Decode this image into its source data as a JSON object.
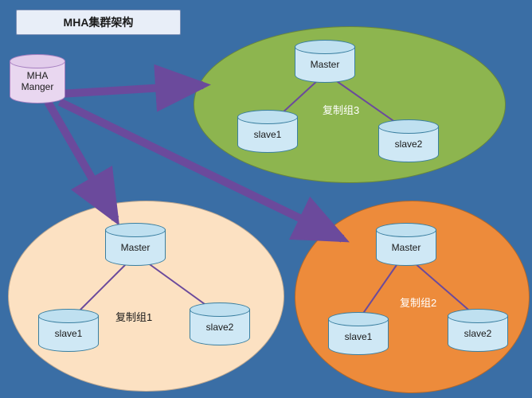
{
  "title": "MHA集群架构",
  "manager": {
    "label": "MHA\nManger"
  },
  "groups": {
    "g1": {
      "label": "复制组1",
      "master": "Master",
      "slave1": "slave1",
      "slave2": "slave2"
    },
    "g2": {
      "label": "复制组2",
      "master": "Master",
      "slave1": "slave1",
      "slave2": "slave2"
    },
    "g3": {
      "label": "复制组3",
      "master": "Master",
      "slave1": "slave1",
      "slave2": "slave2"
    }
  },
  "chart_data": {
    "type": "diagram",
    "title": "MHA集群架构",
    "nodes": [
      {
        "id": "manager",
        "label": "MHA Manger",
        "type": "manager"
      },
      {
        "id": "g1",
        "label": "复制组1",
        "type": "replication-group",
        "members": [
          {
            "id": "g1-master",
            "label": "Master",
            "role": "master"
          },
          {
            "id": "g1-slave1",
            "label": "slave1",
            "role": "slave"
          },
          {
            "id": "g1-slave2",
            "label": "slave2",
            "role": "slave"
          }
        ]
      },
      {
        "id": "g2",
        "label": "复制组2",
        "type": "replication-group",
        "members": [
          {
            "id": "g2-master",
            "label": "Master",
            "role": "master"
          },
          {
            "id": "g2-slave1",
            "label": "slave1",
            "role": "slave"
          },
          {
            "id": "g2-slave2",
            "label": "slave2",
            "role": "slave"
          }
        ]
      },
      {
        "id": "g3",
        "label": "复制组3",
        "type": "replication-group",
        "members": [
          {
            "id": "g3-master",
            "label": "Master",
            "role": "master"
          },
          {
            "id": "g3-slave1",
            "label": "slave1",
            "role": "slave"
          },
          {
            "id": "g3-slave2",
            "label": "slave2",
            "role": "slave"
          }
        ]
      }
    ],
    "edges": [
      {
        "from": "manager",
        "to": "g1",
        "type": "manages"
      },
      {
        "from": "manager",
        "to": "g2",
        "type": "manages"
      },
      {
        "from": "manager",
        "to": "g3",
        "type": "manages"
      },
      {
        "from": "g1-master",
        "to": "g1-slave1",
        "type": "replication"
      },
      {
        "from": "g1-master",
        "to": "g1-slave2",
        "type": "replication"
      },
      {
        "from": "g2-master",
        "to": "g2-slave1",
        "type": "replication"
      },
      {
        "from": "g2-master",
        "to": "g2-slave2",
        "type": "replication"
      },
      {
        "from": "g3-master",
        "to": "g3-slave1",
        "type": "replication"
      },
      {
        "from": "g3-master",
        "to": "g3-slave2",
        "type": "replication"
      }
    ]
  }
}
